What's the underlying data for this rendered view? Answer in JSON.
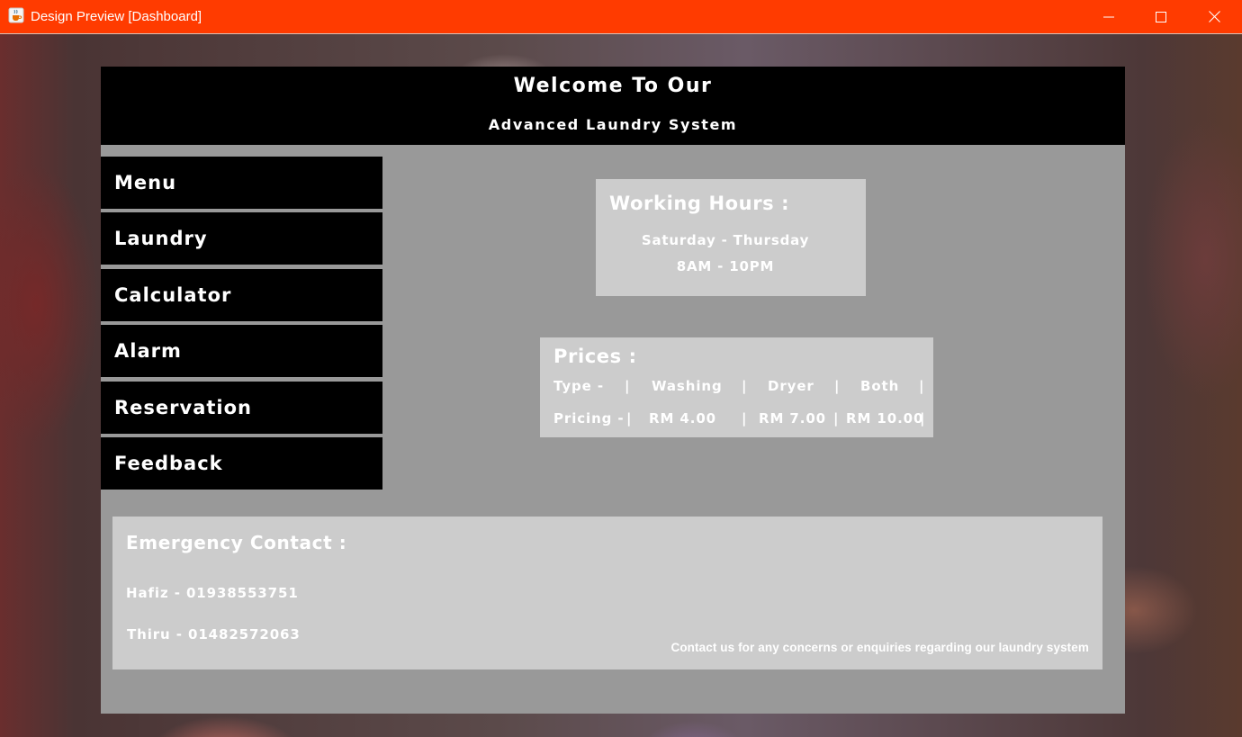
{
  "window": {
    "title": "Design Preview [Dashboard]",
    "app_icon": "java-cup-icon",
    "controls": [
      "minimize-icon",
      "maximize-icon",
      "close-icon"
    ],
    "titlebar_color": "#ff3b00"
  },
  "header": {
    "line1": "Welcome To Our",
    "line2": "Advanced Laundry System"
  },
  "menu": {
    "items": [
      "Menu",
      "Laundry",
      "Calculator",
      "Alarm",
      "Reservation",
      "Feedback"
    ]
  },
  "working_hours": {
    "title": "Working Hours :",
    "days": "Saturday - Thursday",
    "time": "8AM - 10PM"
  },
  "prices": {
    "title": "Prices :",
    "header_row": [
      "Type -",
      "|",
      "Washing",
      "|",
      "Dryer",
      "|",
      "Both",
      "|"
    ],
    "pricing_row": [
      "Pricing -",
      "|",
      "RM 4.00",
      "|",
      "RM 7.00",
      "|",
      "RM 10.00",
      "|"
    ]
  },
  "emergency": {
    "title": "Emergency Contact :",
    "contacts": [
      "Hafiz - 01938553751",
      "Thiru - 01482572063"
    ],
    "note": "Contact us for any concerns or enquiries regarding our laundry system"
  },
  "colors": {
    "panel": "#999999",
    "card": "#cccccc",
    "button": "#000000",
    "text": "#ffffff"
  }
}
